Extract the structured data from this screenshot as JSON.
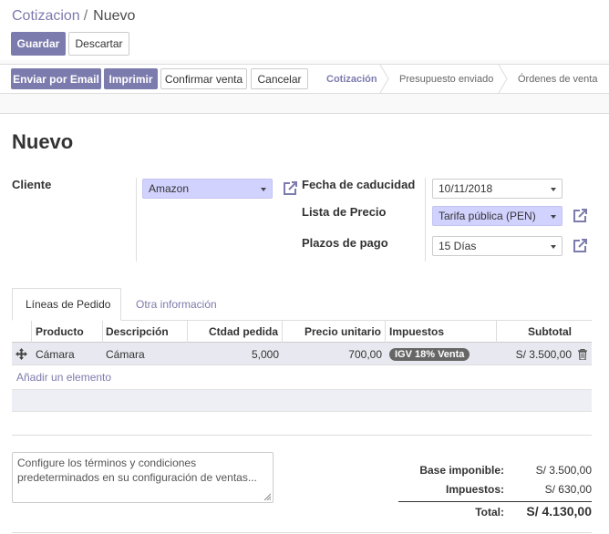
{
  "breadcrumb": {
    "parent": "Cotizacion",
    "separator": "/",
    "current": "Nuevo"
  },
  "actions": {
    "save": "Guardar",
    "discard": "Descartar"
  },
  "statusbar": {
    "buttons": {
      "email": "Enviar por Email",
      "print": "Imprimir",
      "confirm": "Confirmar venta",
      "cancel": "Cancelar"
    },
    "stages": [
      "Cotización",
      "Presupuesto enviado",
      "Órdenes de venta"
    ],
    "active_stage": "Cotización"
  },
  "form": {
    "title": "Nuevo",
    "customer": {
      "label": "Cliente",
      "value": "Amazon"
    },
    "expiration": {
      "label": "Fecha de caducidad",
      "value": "10/11/2018"
    },
    "pricelist": {
      "label": "Lista de Precio",
      "value": "Tarifa pública (PEN)"
    },
    "payment_terms": {
      "label": "Plazos de pago",
      "value": "15 Días"
    }
  },
  "tabs": [
    "Líneas de Pedido",
    "Otra información"
  ],
  "order_lines": {
    "columns": [
      "Producto",
      "Descripción",
      "Ctdad pedida",
      "Precio unitario",
      "Impuestos",
      "Subtotal"
    ],
    "rows": [
      {
        "product": "Cámara",
        "description": "Cámara",
        "qty": "5,000",
        "price": "700,00",
        "tax": "IGV 18% Venta",
        "subtotal": "S/ 3.500,00"
      }
    ],
    "add_line": "Añadir un elemento"
  },
  "terms_placeholder": "Configure los términos y condiciones predeterminados en su configuración de ventas...",
  "totals": {
    "untaxed_label": "Base imponible:",
    "untaxed_value": "S/ 3.500,00",
    "taxes_label": "Impuestos:",
    "taxes_value": "S/ 630,00",
    "total_label": "Total:",
    "total_value": "S/ 4.130,00"
  },
  "colors": {
    "primary": "#7c7bad",
    "required_field": "#d2d2ff",
    "tax_badge": "#666666"
  },
  "icons": {
    "external_link": "external-link-icon",
    "drag_handle": "drag-handle-icon",
    "delete": "trash-icon",
    "dropdown": "caret-down-icon"
  }
}
